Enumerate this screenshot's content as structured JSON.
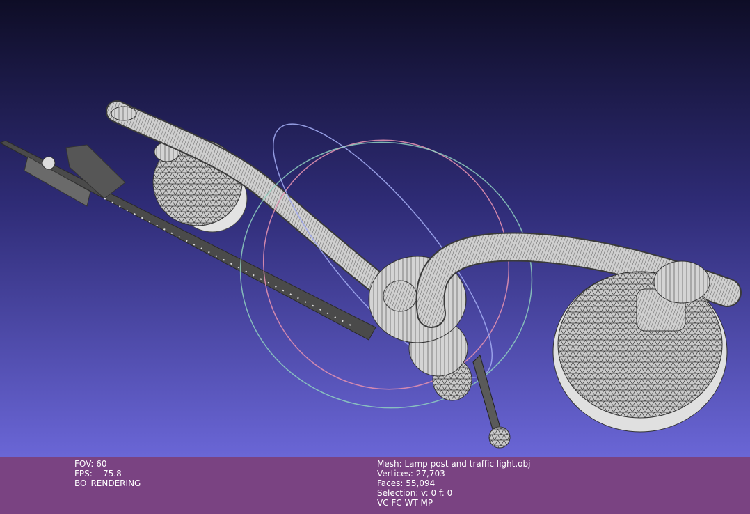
{
  "viewport": {
    "background_top": "#0e0d26",
    "background_bottom": "#6a66d6",
    "mesh_fill": "#c8c8c8",
    "mesh_wire": "#333333"
  },
  "info_left": {
    "fov": "FOV: 60",
    "fps": "FPS:    75.8",
    "render_mode": "BO_RENDERING"
  },
  "info_right": {
    "mesh": "Mesh: Lamp post and traffic light.obj",
    "vertices": "Vertices: 27,703",
    "faces": "Faces: 55,094",
    "selection": "Selection: v: 0 f: 0",
    "flags": "VC FC WT MP"
  },
  "colors": {
    "infobar": "#7a4382",
    "trackball_red": "#e08fb0",
    "trackball_green": "#8fd0c0",
    "trackball_blue": "#a0a8f0"
  }
}
